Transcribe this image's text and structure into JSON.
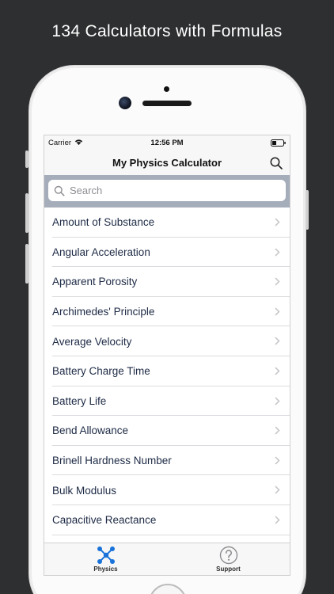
{
  "promo": {
    "headline": "134 Calculators with Formulas"
  },
  "status_bar": {
    "carrier": "Carrier",
    "time": "12:56 PM"
  },
  "nav": {
    "title": "My Physics Calculator"
  },
  "search": {
    "placeholder": "Search"
  },
  "calculators": [
    {
      "label": "Amount of Substance"
    },
    {
      "label": "Angular Acceleration"
    },
    {
      "label": "Apparent Porosity"
    },
    {
      "label": "Archimedes' Principle"
    },
    {
      "label": "Average Velocity"
    },
    {
      "label": "Battery Charge Time"
    },
    {
      "label": "Battery Life"
    },
    {
      "label": "Bend Allowance"
    },
    {
      "label": "Brinell Hardness Number"
    },
    {
      "label": "Bulk Modulus"
    },
    {
      "label": "Capacitive Reactance"
    }
  ],
  "tabs": [
    {
      "label": "Physics",
      "icon": "physics-network-icon"
    },
    {
      "label": "Support",
      "icon": "question-circle-icon"
    }
  ],
  "colors": {
    "background": "#2e2f31",
    "search_band": "#a5acba",
    "row_text": "#1d2a45",
    "accent": "#1a73d9"
  }
}
